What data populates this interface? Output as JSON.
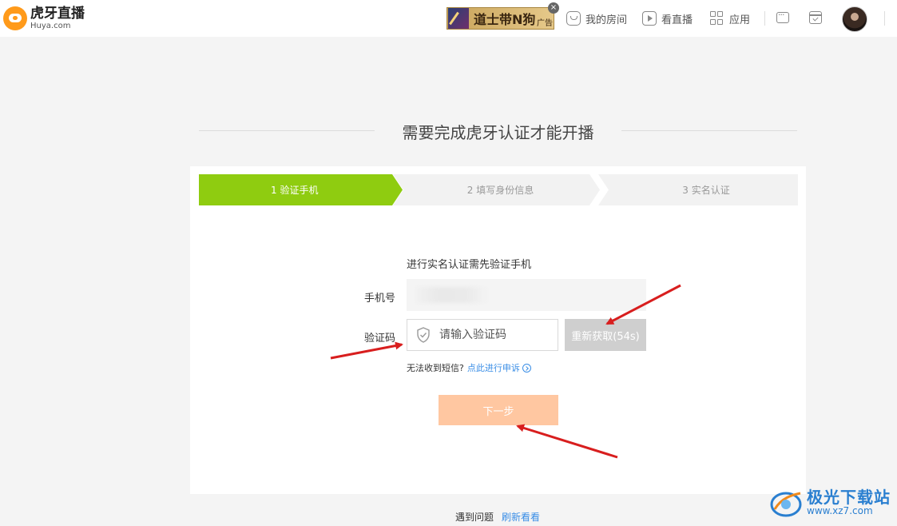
{
  "header": {
    "logo_cn": "虎牙直播",
    "logo_en": "Huya.com",
    "ad_text": "道士带N狗",
    "ad_tag": "广告",
    "ad_close": "×",
    "nav": [
      {
        "label": "我的房间",
        "icon": "home-icon"
      },
      {
        "label": "看直播",
        "icon": "play-icon"
      },
      {
        "label": "应用",
        "icon": "apps-icon"
      }
    ],
    "icons": [
      "message-icon",
      "calendar-icon",
      "avatar"
    ]
  },
  "main": {
    "title": "需要完成虎牙认证才能开播",
    "steps": [
      {
        "label": "1 验证手机",
        "state": "active"
      },
      {
        "label": "2 填写身份信息",
        "state": "pending"
      },
      {
        "label": "3 实名认证",
        "state": "pending"
      }
    ],
    "hint": "进行实名认证需先验证手机",
    "phone_label": "手机号",
    "phone_value": "",
    "code_label": "验证码",
    "code_placeholder": "请输入验证码",
    "resend_label": "重新获取(54s)",
    "help_text": "无法收到短信?",
    "help_link": "点此进行申诉",
    "next_label": "下一步"
  },
  "footer": {
    "text": "遇到问题",
    "link": "刷新看看"
  },
  "watermark": {
    "cn": "极光下载站",
    "url": "www.xz7.com"
  },
  "colors": {
    "active_step": "#8fcc10",
    "next_button": "#ffc7a1",
    "resend_button": "#cfcfcf",
    "link": "#3a8ee6",
    "annotation_arrow": "#d81e1e"
  }
}
